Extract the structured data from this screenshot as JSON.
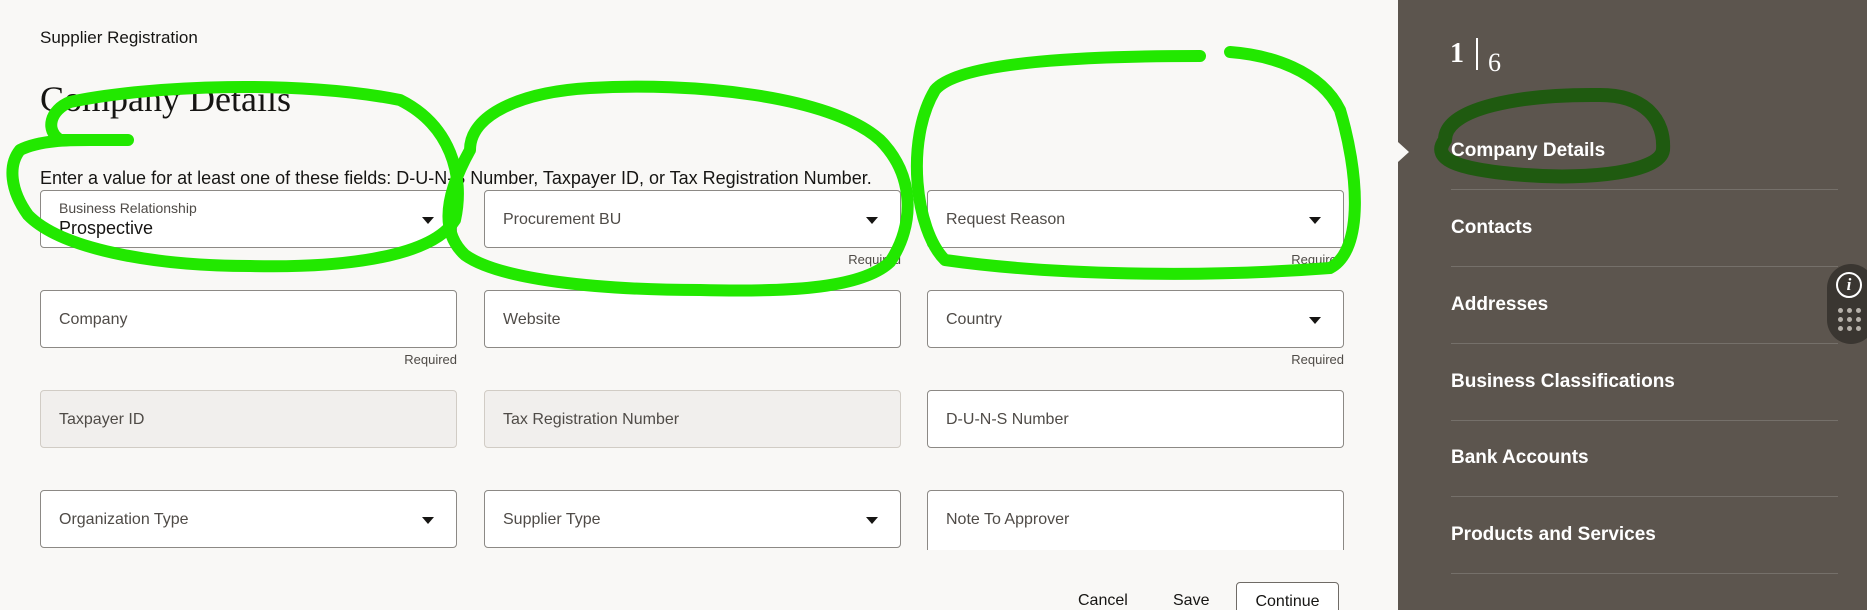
{
  "header": {
    "breadcrumb": "Supplier Registration",
    "title": "Company Details"
  },
  "instruction": "Enter a value for at least one of these fields: D-U-N-S Number, Taxpayer ID, or Tax Registration Number.",
  "fields": {
    "business_relationship": {
      "label": "Business Relationship",
      "value": "Prospective"
    },
    "procurement_bu": {
      "label": "Procurement BU",
      "hint": "Required"
    },
    "request_reason": {
      "label": "Request Reason",
      "hint": "Required"
    },
    "company": {
      "label": "Company",
      "hint": "Required"
    },
    "website": {
      "label": "Website"
    },
    "country": {
      "label": "Country",
      "hint": "Required"
    },
    "taxpayer_id": {
      "label": "Taxpayer ID"
    },
    "tax_registration_number": {
      "label": "Tax Registration Number"
    },
    "duns_number": {
      "label": "D-U-N-S Number"
    },
    "organization_type": {
      "label": "Organization Type"
    },
    "supplier_type": {
      "label": "Supplier Type"
    },
    "note_to_approver": {
      "label": "Note To Approver"
    }
  },
  "actions": {
    "cancel": "Cancel",
    "save": "Save",
    "continue": "Continue"
  },
  "sidebar": {
    "step_current": "1",
    "step_total": "6",
    "items": [
      {
        "label": "Company Details"
      },
      {
        "label": "Contacts"
      },
      {
        "label": "Addresses"
      },
      {
        "label": "Business Classifications"
      },
      {
        "label": "Bank Accounts"
      },
      {
        "label": "Products and Services"
      }
    ]
  },
  "widgets": {
    "info_glyph": "i",
    "info_icon": "info-icon",
    "apps_icon": "grid-dots-icon"
  },
  "colors": {
    "sidebar_bg": "#5c554e",
    "annotation_green": "#22e800",
    "annotation_dark_green": "#1f5a10",
    "page_bg": "#f9f8f6"
  }
}
